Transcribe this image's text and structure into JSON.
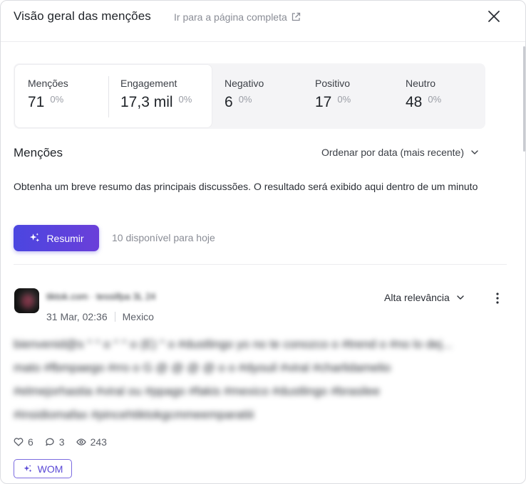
{
  "header": {
    "title": "Visão geral das menções",
    "goto_link": "Ir para a página completa"
  },
  "stats": [
    {
      "label": "Menções",
      "value": "71",
      "pct": "0%"
    },
    {
      "label": "Engagement",
      "value": "17,3 mil",
      "pct": "0%"
    },
    {
      "label": "Negativo",
      "value": "6",
      "pct": "0%"
    },
    {
      "label": "Positivo",
      "value": "17",
      "pct": "0%"
    },
    {
      "label": "Neutro",
      "value": "48",
      "pct": "0%"
    }
  ],
  "mentions": {
    "title": "Menções",
    "sort_label": "Ordenar por data (mais recente)",
    "summary_desc": "Obtenha um breve resumo das principais discussões. O resultado será exibido aqui dentro de um minuto",
    "summarize_button": "Resumir",
    "available_today": "10 disponível para hoje"
  },
  "post": {
    "author": "tiktok.com · tessiifpa 3L 24",
    "date": "31 Mar, 02:36",
    "location": "Mexico",
    "relevance": "Alta relevância",
    "text_line1": "bienvenid@s ° ° o ° ° o (E) ° o #dustlingo yo no te conozco o #trend o #no lo dej...",
    "text_line2": "mato #fbmpaego #rro o G @ @ @ @ o o #dyouil #viral #charlidamelio",
    "text_line3": "#elmejorhastia #viral ou #ppago #fakis #mexico #dustlingo #brasilee",
    "text_line4": "#insidiomafax #pincehtiktokgcmmeemparatiii",
    "likes": "6",
    "comments": "3",
    "views": "243",
    "badge": "WOM"
  },
  "colors": {
    "accent": "#5a49d6",
    "button_gradient_start": "#4b46e0",
    "button_gradient_end": "#6a3fd9",
    "stats_bg": "#f4f4f6"
  }
}
